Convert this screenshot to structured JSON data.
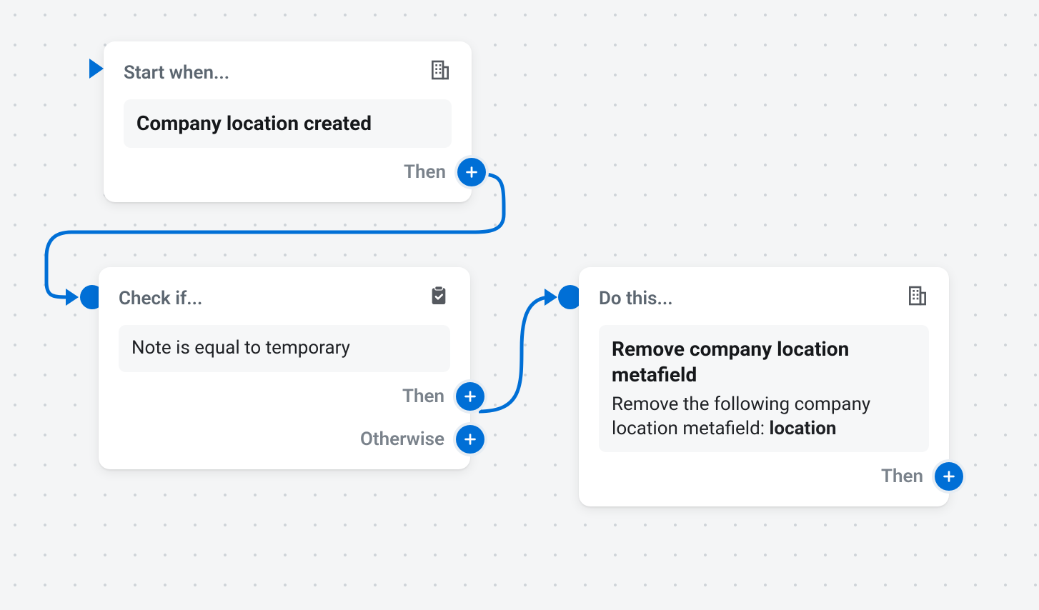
{
  "nodes": {
    "start": {
      "header": "Start when...",
      "body_title": "Company location created",
      "out_then": "Then"
    },
    "condition": {
      "header": "Check if...",
      "body_text": "Note is equal to temporary",
      "out_then": "Then",
      "out_otherwise": "Otherwise"
    },
    "action": {
      "header": "Do this...",
      "body_title": "Remove company location metafield",
      "body_desc_prefix": "Remove the following company location metafield: ",
      "body_desc_bold": "location",
      "out_then": "Then"
    }
  },
  "colors": {
    "accent": "#006fd6"
  }
}
